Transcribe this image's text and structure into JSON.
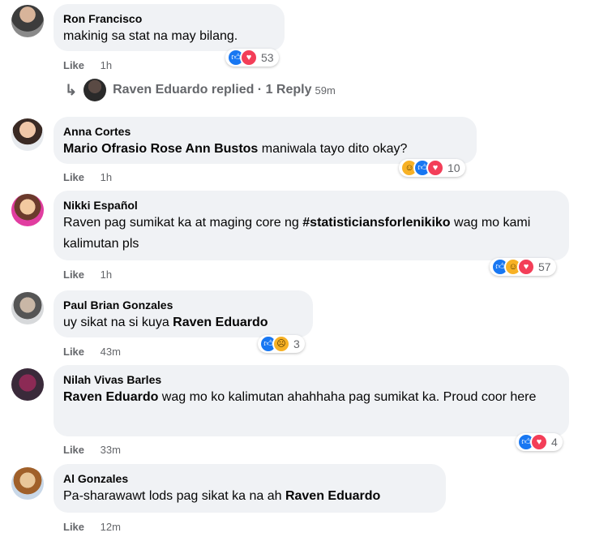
{
  "comments": [
    {
      "author": "Ron Francisco",
      "text_parts": [
        {
          "t": "makinig sa stat na may bilang."
        }
      ],
      "like_label": "Like",
      "time": "1h",
      "reaction_count": "53",
      "reaction_icons": [
        "like-icon",
        "heart-icon"
      ]
    },
    {
      "author": "Anna Cortes",
      "text_parts": [
        {
          "t": "Mario Ofrasio Rose Ann Bustos",
          "b": true
        },
        {
          "t": " maniwala tayo dito okay?"
        }
      ],
      "like_label": "Like",
      "time": "1h",
      "reaction_count": "10",
      "reaction_icons": [
        "haha-icon",
        "like-icon",
        "heart-icon"
      ]
    },
    {
      "author": "Nikki Español",
      "text_parts": [
        {
          "t": "Raven pag sumikat ka at maging core ng "
        },
        {
          "t": "#statisticiansforlenikiko",
          "b": true
        },
        {
          "t": " wag mo kami kalimutan pls"
        }
      ],
      "like_label": "Like",
      "time": "1h",
      "reaction_count": "57",
      "reaction_icons": [
        "like-icon",
        "haha-icon",
        "heart-icon"
      ]
    },
    {
      "author": "Paul Brian Gonzales",
      "text_parts": [
        {
          "t": "uy sikat na si kuya "
        },
        {
          "t": "Raven Eduardo",
          "b": true
        }
      ],
      "like_label": "Like",
      "time": "43m",
      "reaction_count": "3",
      "reaction_icons": [
        "like-icon",
        "sad-icon"
      ]
    },
    {
      "author": "Nilah Vivas Barles",
      "text_parts": [
        {
          "t": "Raven Eduardo",
          "b": true
        },
        {
          "t": " wag mo ko kalimutan ahahhaha pag sumikat ka. Proud coor here"
        }
      ],
      "like_label": "Like",
      "time": "33m",
      "reaction_count": "4",
      "reaction_icons": [
        "like-icon",
        "heart-icon"
      ]
    },
    {
      "author": "Al Gonzales",
      "text_parts": [
        {
          "t": "Pa-sharawawt lods pag sikat ka na ah "
        },
        {
          "t": "Raven Eduardo",
          "b": true
        }
      ],
      "like_label": "Like",
      "time": "12m",
      "reaction_count": "",
      "reaction_icons": []
    }
  ],
  "reply_summary": {
    "name": "Raven Eduardo replied",
    "separator": " · ",
    "count": "1 Reply",
    "time": "59m"
  },
  "colors": {
    "bubble": "#f0f2f5",
    "meta": "#65676b",
    "like": "#1877f2",
    "heart": "#f33e58",
    "haha": "#f7b125"
  }
}
